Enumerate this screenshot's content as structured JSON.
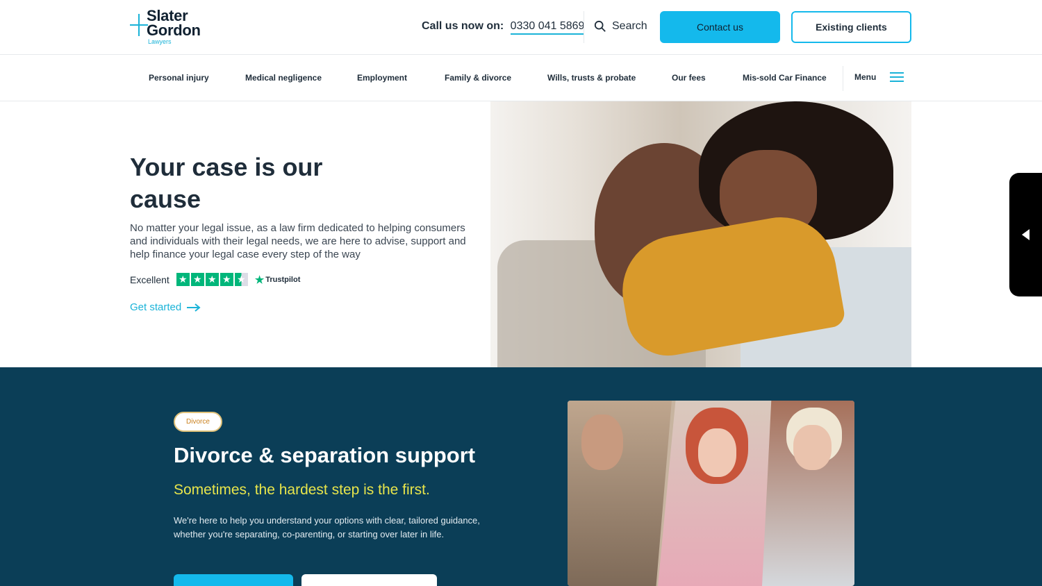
{
  "brand": {
    "name_line1": "Slater",
    "name_line2": "Gordon",
    "tagline": "Lawyers",
    "accent": "#1ab3d8"
  },
  "header": {
    "call_label": "Call us now on:",
    "phone": "0330 041 5869",
    "search_label": "Search",
    "search_icon": "search-icon",
    "contact_label": "Contact us",
    "existing_label": "Existing clients"
  },
  "nav": {
    "items": [
      {
        "label": "Personal injury"
      },
      {
        "label": "Medical negligence"
      },
      {
        "label": "Employment"
      },
      {
        "label": "Family & divorce"
      },
      {
        "label": "Wills, trusts & probate"
      },
      {
        "label": "Our fees"
      },
      {
        "label": "Mis-sold Car Finance"
      }
    ],
    "menu_label": "Menu",
    "menu_icon": "hamburger-icon"
  },
  "hero": {
    "title": "Your case is our cause",
    "text": "No matter your legal issue, as a law firm dedicated to helping consumers and individuals with their legal needs, we are here to advise, support and help finance your legal case every step of the way",
    "rating_label": "Excellent",
    "rating_stars": 4.5,
    "trustpilot_label": "Trustpilot",
    "cta_label": "Get started",
    "cta_icon": "arrow-right-icon"
  },
  "side_tab": {
    "icon": "triangle-left-icon"
  },
  "divorce_section": {
    "badge": "Divorce",
    "title": "Divorce & separation support",
    "subtitle": "Sometimes, the hardest step is the first.",
    "text": "We're here to help you understand your options with clear, tailored guidance, whether you're separating, co-parenting, or starting over later in life.",
    "background": "#0b3e57",
    "subtitle_color": "#e8e54b"
  }
}
